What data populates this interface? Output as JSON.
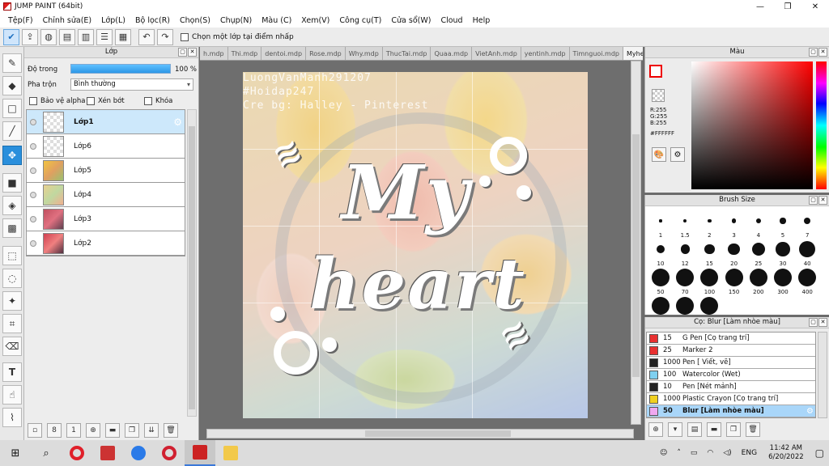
{
  "window": {
    "title": "JUMP PAINT (64bit)",
    "min_icon": "minimize-icon",
    "max_icon": "maximize-icon",
    "close_icon": "close-icon"
  },
  "menu": [
    "Tệp(F)",
    "Chỉnh sửa(E)",
    "Lớp(L)",
    "Bộ lọc(R)",
    "Chọn(S)",
    "Chụp(N)",
    "Màu (C)",
    "Xem(V)",
    "Công cụ(T)",
    "Cửa sổ(W)",
    "Cloud",
    "Help"
  ],
  "toolbar": {
    "snap_label": "Chọn một lớp tại điểm nhấp"
  },
  "layer_panel": {
    "title": "Lớp",
    "opacity_label": "Độ trong",
    "opacity_value": "100 %",
    "opacity_fraction": 1.0,
    "blend_label": "Pha trộn",
    "blend_value": "Bình thường",
    "protect_alpha": "Bảo vệ alpha",
    "clipping": "Xén bớt",
    "lock": "Khóa",
    "layers": [
      {
        "name": "Lớp1",
        "selected": true,
        "thumb": "trans"
      },
      {
        "name": "Lớp6",
        "thumb": "trans"
      },
      {
        "name": "Lớp5",
        "thumb": "t5"
      },
      {
        "name": "Lớp4",
        "thumb": "t4"
      },
      {
        "name": "Lớp3",
        "thumb": "t3"
      },
      {
        "name": "Lớp2",
        "thumb": "t2"
      }
    ]
  },
  "tabs": [
    "h.mdp",
    "Thi.mdp",
    "dentoi.mdp",
    "Rose.mdp",
    "Why.mdp",
    "ThucTai.mdp",
    "Quaa.mdp",
    "VietAnh.mdp",
    "yentinh.mdp",
    "Timnguoi.mdp",
    "Myheart.mdp"
  ],
  "active_tab": "Myheart.mdp",
  "artwork": {
    "credit1": "LuongVanManh291207",
    "credit2": "#Hoidap247",
    "credit3": "Cre bg: Halley - Pinterest",
    "word1": "My",
    "word2": "heart"
  },
  "color_panel": {
    "title": "Màu",
    "r": "R:255",
    "g": "G:255",
    "b": "B:255",
    "hex": "#FFFFFF",
    "accent": "#ff0000"
  },
  "brush_panel": {
    "title": "Brush Size",
    "sizes": [
      "1",
      "1.5",
      "2",
      "3",
      "4",
      "5",
      "7",
      "10",
      "12",
      "15",
      "20",
      "25",
      "30",
      "40",
      "50",
      "70",
      "100",
      "150",
      "200",
      "300",
      "400",
      "",
      "",
      ""
    ]
  },
  "tool_panel": {
    "title": "Cọ: Blur [Làm nhòe màu]",
    "items": [
      {
        "size": "15",
        "name": "G Pen [Cọ trang trí]",
        "color": "#e83030"
      },
      {
        "size": "25",
        "name": "Marker 2",
        "color": "#e83030"
      },
      {
        "size": "1000",
        "name": "Pen [ Viết, vẽ]",
        "color": "#222222"
      },
      {
        "size": "100",
        "name": "Watercolor (Wet)",
        "color": "#7fd0f0"
      },
      {
        "size": "10",
        "name": "Pen [Nét mảnh]",
        "color": "#222222"
      },
      {
        "size": "1000",
        "name": "Plastic Crayon [Cọ trang trí]",
        "color": "#f0d020"
      },
      {
        "size": "50",
        "name": "Blur [Làm nhòe màu]",
        "color": "#f0a8f0",
        "selected": true
      }
    ]
  },
  "taskbar": {
    "lang": "ENG",
    "time": "11:42 AM",
    "date": "6/20/2022"
  }
}
